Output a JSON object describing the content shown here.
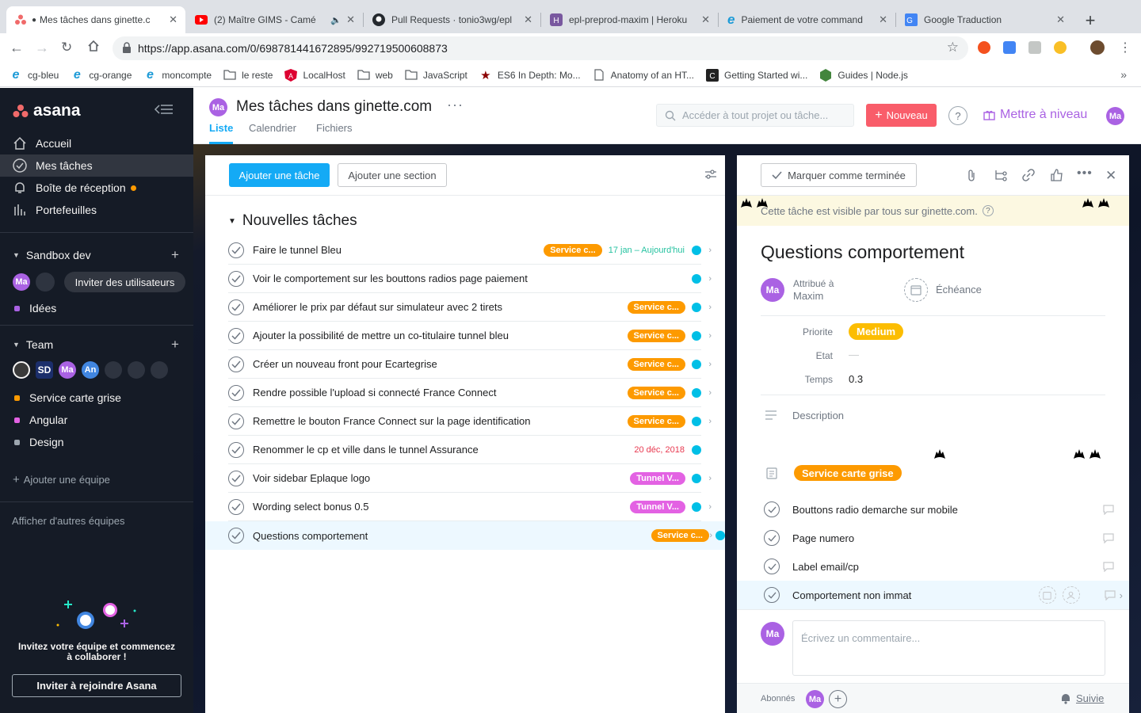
{
  "browser": {
    "tabs": [
      {
        "title": "Mes tâches dans ginette.c",
        "active": true
      },
      {
        "title": "(2) Maître GIMS - Camé"
      },
      {
        "title": "Pull Requests · tonio3wg/epl"
      },
      {
        "title": "epl-preprod-maxim | Heroku"
      },
      {
        "title": "Paiement de votre command"
      },
      {
        "title": "Google Traduction"
      }
    ],
    "url": "https://app.asana.com/0/698781441672895/992719500608873",
    "bookmarks": [
      "cg-bleu",
      "cg-orange",
      "moncompte",
      "le reste",
      "LocalHost",
      "web",
      "JavaScript",
      "ES6 In Depth: Mo...",
      "Anatomy of an HT...",
      "Getting Started wi...",
      "Guides | Node.js"
    ]
  },
  "sidebar": {
    "logo": "asana",
    "nav": [
      {
        "label": "Accueil"
      },
      {
        "label": "Mes tâches"
      },
      {
        "label": "Boîte de réception"
      },
      {
        "label": "Portefeuilles"
      }
    ],
    "workspace": {
      "name": "Sandbox dev",
      "avatar": "Ma",
      "invite": "Inviter des utilisateurs",
      "projects": [
        {
          "name": "Idées",
          "color": "#aa62e3"
        }
      ]
    },
    "team": {
      "name": "Team",
      "avatars": [
        "Ma",
        "An"
      ],
      "projects": [
        {
          "name": "Service carte grise",
          "color": "#fd9a00"
        },
        {
          "name": "Angular",
          "color": "#e362e3"
        },
        {
          "name": "Design",
          "color": "#9ca6af"
        }
      ]
    },
    "add_team": "Ajouter une équipe",
    "more_teams": "Afficher d'autres équipes",
    "invite_text": "Invitez votre équipe et commencez à collaborer !",
    "invite_button": "Inviter à rejoindre Asana"
  },
  "header": {
    "avatar": "Ma",
    "title": "Mes tâches dans ginette.com",
    "more": "···",
    "tabs": [
      "Liste",
      "Calendrier",
      "Fichiers"
    ],
    "search_placeholder": "Accéder à tout projet ou tâche...",
    "new_button": "Nouveau",
    "help": "?",
    "upgrade": "Mettre à niveau",
    "user_avatar": "Ma"
  },
  "list": {
    "add_task": "Ajouter une tâche",
    "add_section": "Ajouter une section",
    "section": "Nouvelles tâches",
    "tasks": [
      {
        "name": "Faire le tunnel Bleu",
        "tag": "Service c...",
        "tag_color": "#fd9a00",
        "date": "17 jan – Aujourd'hui",
        "date_color": "#25c2a0"
      },
      {
        "name": "Voir le comportement sur les bouttons radios page paiement",
        "tag": "",
        "tag_color": "",
        "date": "",
        "date_color": ""
      },
      {
        "name": "Améliorer le prix par défaut sur simulateur avec 2 tirets",
        "tag": "Service c...",
        "tag_color": "#fd9a00",
        "date": "",
        "date_color": ""
      },
      {
        "name": "Ajouter la possibilité de mettre un co-titulaire tunnel bleu",
        "tag": "Service c...",
        "tag_color": "#fd9a00",
        "date": "",
        "date_color": ""
      },
      {
        "name": "Créer un nouveau front pour Ecartegrise",
        "tag": "Service c...",
        "tag_color": "#fd9a00",
        "date": "",
        "date_color": ""
      },
      {
        "name": "Rendre possible l'upload si connecté France Connect",
        "tag": "Service c...",
        "tag_color": "#fd9a00",
        "date": "",
        "date_color": ""
      },
      {
        "name": "Remettre le bouton France Connect sur la page identification",
        "tag": "Service c...",
        "tag_color": "#fd9a00",
        "date": "",
        "date_color": ""
      },
      {
        "name": "Renommer le cp et ville dans le tunnel Assurance",
        "tag": "",
        "tag_color": "",
        "date": "20 déc, 2018",
        "date_color": "#e8384f"
      },
      {
        "name": "Voir sidebar Eplaque logo",
        "tag": "Tunnel V...",
        "tag_color": "#e362e3",
        "date": "",
        "date_color": ""
      },
      {
        "name": "Wording select bonus 0.5",
        "tag": "Tunnel V...",
        "tag_color": "#e362e3",
        "date": "",
        "date_color": ""
      },
      {
        "name": "Questions comportement",
        "tag": "Service c...",
        "tag_color": "#fd9a00",
        "date": "",
        "date_color": ""
      }
    ]
  },
  "detail": {
    "mark_complete": "Marquer comme terminée",
    "visibility": "Cette tâche est visible par tous sur ginette.com.",
    "title": "Questions comportement",
    "assigned_label": "Attribué à",
    "assignee": "Maxim",
    "assignee_avatar": "Ma",
    "due_label": "Échéance",
    "fields": [
      {
        "label": "Priorite",
        "value": "Medium"
      },
      {
        "label": "Etat",
        "value": "—"
      },
      {
        "label": "Temps",
        "value": "0.3"
      }
    ],
    "description_placeholder": "Description",
    "project_tag": "Service carte grise",
    "subtasks": [
      "Bouttons radio demarche sur mobile",
      "Page numero",
      "Label email/cp",
      "Comportement non immat"
    ],
    "comment_avatar": "Ma",
    "comment_placeholder": "Écrivez un commentaire...",
    "followers_label": "Abonnés",
    "follower_avatar": "Ma",
    "follow": "Suivie"
  }
}
